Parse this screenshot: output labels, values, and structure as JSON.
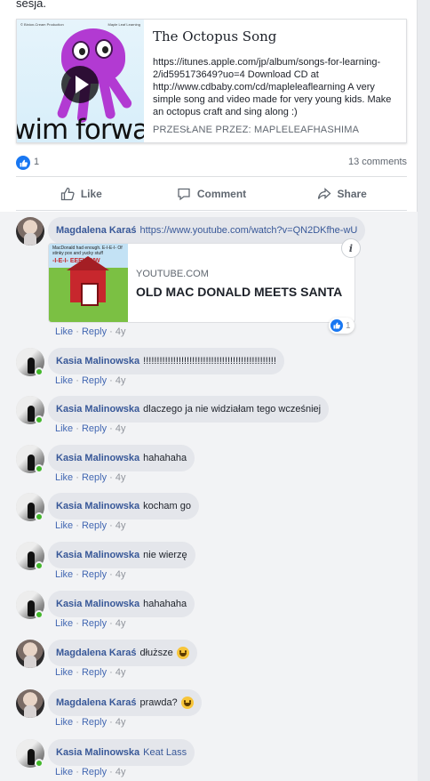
{
  "post": {
    "top_text": "sesja.",
    "share_card": {
      "thumb_topline_left": "© Binion-Cream Production",
      "thumb_topline_right": "Maple Leaf Learning",
      "thumb_caption": "wim forwar",
      "title": "The Octopus Song",
      "description": "https://itunes.apple.com/jp/album/songs-for-learning-2/id595173649?uo=4 Download CD at http://www.cdbaby.com/cd/mapleleaflearning A very simple song and video made for very young kids. Make an octopus craft and sing along :)",
      "source": "PRZESŁANE PRZEZ: MAPLELEAFHASHIMA"
    },
    "reaction_count": "1",
    "comments_count": "13 comments",
    "actions": {
      "like": "Like",
      "comment": "Comment",
      "share": "Share"
    }
  },
  "comment_meta": {
    "like": "Like",
    "reply": "Reply",
    "age": "4y",
    "sep": "·"
  },
  "comments": [
    {
      "author": "Magdalena Karaś",
      "text": "https://www.youtube.com/watch?v=QN2DKfhe-wU",
      "is_link": true,
      "emoji": false
    },
    {
      "author": "Kasia Malinowska",
      "text": "!!!!!!!!!!!!!!!!!!!!!!!!!!!!!!!!!!!!!!!!!!!!!!!!!",
      "emoji": false
    },
    {
      "author": "Kasia Malinowska",
      "text": "dlaczego ja nie widziałam tego wcześniej",
      "emoji": false
    },
    {
      "author": "Kasia Malinowska",
      "text": "hahahaha",
      "emoji": false
    },
    {
      "author": "Kasia Malinowska",
      "text": "kocham go",
      "emoji": false
    },
    {
      "author": "Kasia Malinowska",
      "text": "nie wierzę",
      "emoji": false
    },
    {
      "author": "Kasia Malinowska",
      "text": "hahahaha",
      "emoji": false
    },
    {
      "author": "Magdalena Karaś",
      "text": "dłuższe",
      "emoji": true
    },
    {
      "author": "Magdalena Karaś",
      "text": "prawda?",
      "emoji": true
    },
    {
      "author": "Kasia Malinowska",
      "text": "Keat Lass",
      "is_link": true,
      "emoji": false
    }
  ],
  "embed": {
    "thumb_text": "MacDonald had enough. E-I-E-I- Of stinky pox and yucky stuff",
    "thumb_text2": "-I-E-I-  EEEWWW",
    "source": "YOUTUBE.COM",
    "title": "OLD MAC DONALD MEETS SANTA",
    "reaction_count": "1",
    "info_label": "i"
  },
  "colors": {
    "link": "#385898",
    "accent": "#1877f2",
    "online": "#42b72a"
  }
}
